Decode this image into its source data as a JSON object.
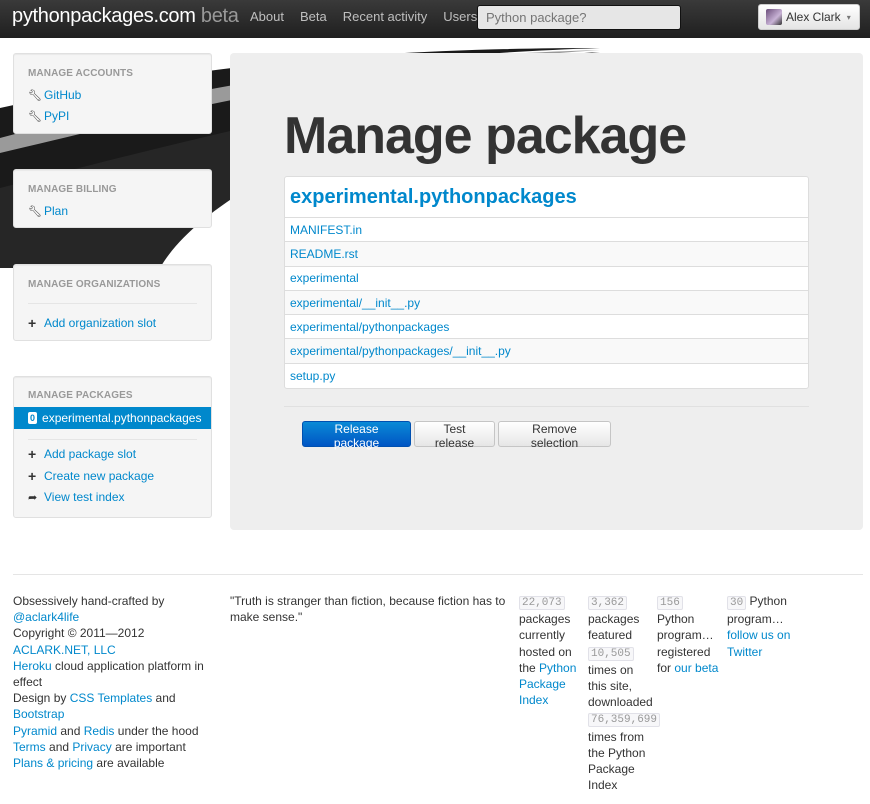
{
  "header": {
    "brand": "pythonpackages.com",
    "brand_suffix": "beta",
    "nav": [
      "About",
      "Beta",
      "Recent activity",
      "Users"
    ],
    "search_placeholder": "Python package?",
    "user_name": "Alex Clark",
    "caret": "▾"
  },
  "sidebar": {
    "accounts": {
      "heading": "Manage accounts",
      "links": [
        "GitHub",
        "PyPI"
      ]
    },
    "billing": {
      "heading": "Manage billing",
      "links": [
        "Plan"
      ]
    },
    "organizations": {
      "heading": "Manage organizations",
      "add_label": "Add organization slot"
    },
    "packages": {
      "heading": "Manage packages",
      "active_count": "0",
      "active_package": "experimental.pythonpackages",
      "add_label": "Add package slot",
      "create_label": "Create new package",
      "test_index_label": "View test index"
    }
  },
  "main": {
    "title": "Manage package",
    "package_name": "experimental.pythonpackages",
    "files": [
      "MANIFEST.in",
      "README.rst",
      "experimental",
      "experimental/__init__.py",
      "experimental/pythonpackages",
      "experimental/pythonpackages/__init__.py",
      "setup.py"
    ],
    "buttons": {
      "release": "Release package",
      "test": "Test release",
      "remove": "Remove selection"
    }
  },
  "footer": {
    "col1": {
      "l1": "Obsessively hand-crafted by",
      "author": "@aclark4life",
      "copyright": "Copyright © 2011—2012",
      "company": "ACLARK.NET, LLC",
      "heroku": "Heroku",
      "heroku_rest": "cloud application platform in effect",
      "design_by": "Design by",
      "css_templates": "CSS Templates",
      "and": "and",
      "bootstrap": "Bootstrap",
      "pyramid": "Pyramid",
      "and2": "and",
      "redis": "Redis",
      "under_hood": "under the hood",
      "terms": "Terms",
      "and3": "and",
      "privacy": "Privacy",
      "are_important": "are important",
      "plans": "Plans & pricing",
      "are_available": "are available"
    },
    "quote": "\"Truth is stranger than fiction, because fiction has to make sense.\"",
    "stat1": {
      "count": "22,073",
      "text": "packages currently hosted on the",
      "link": "Python Package Index"
    },
    "stat2": {
      "count": "3,362",
      "text1": "packages featured",
      "count2": "10,505",
      "text2": "times on this site, downloaded",
      "count3": "76,359,699",
      "text3": "times from the Python Package Index"
    },
    "stat3": {
      "count": "156",
      "text": "Python program… registered for",
      "link": "our beta"
    },
    "stat4": {
      "count": "30",
      "text": "Python program…",
      "link": "follow us on Twitter"
    }
  }
}
